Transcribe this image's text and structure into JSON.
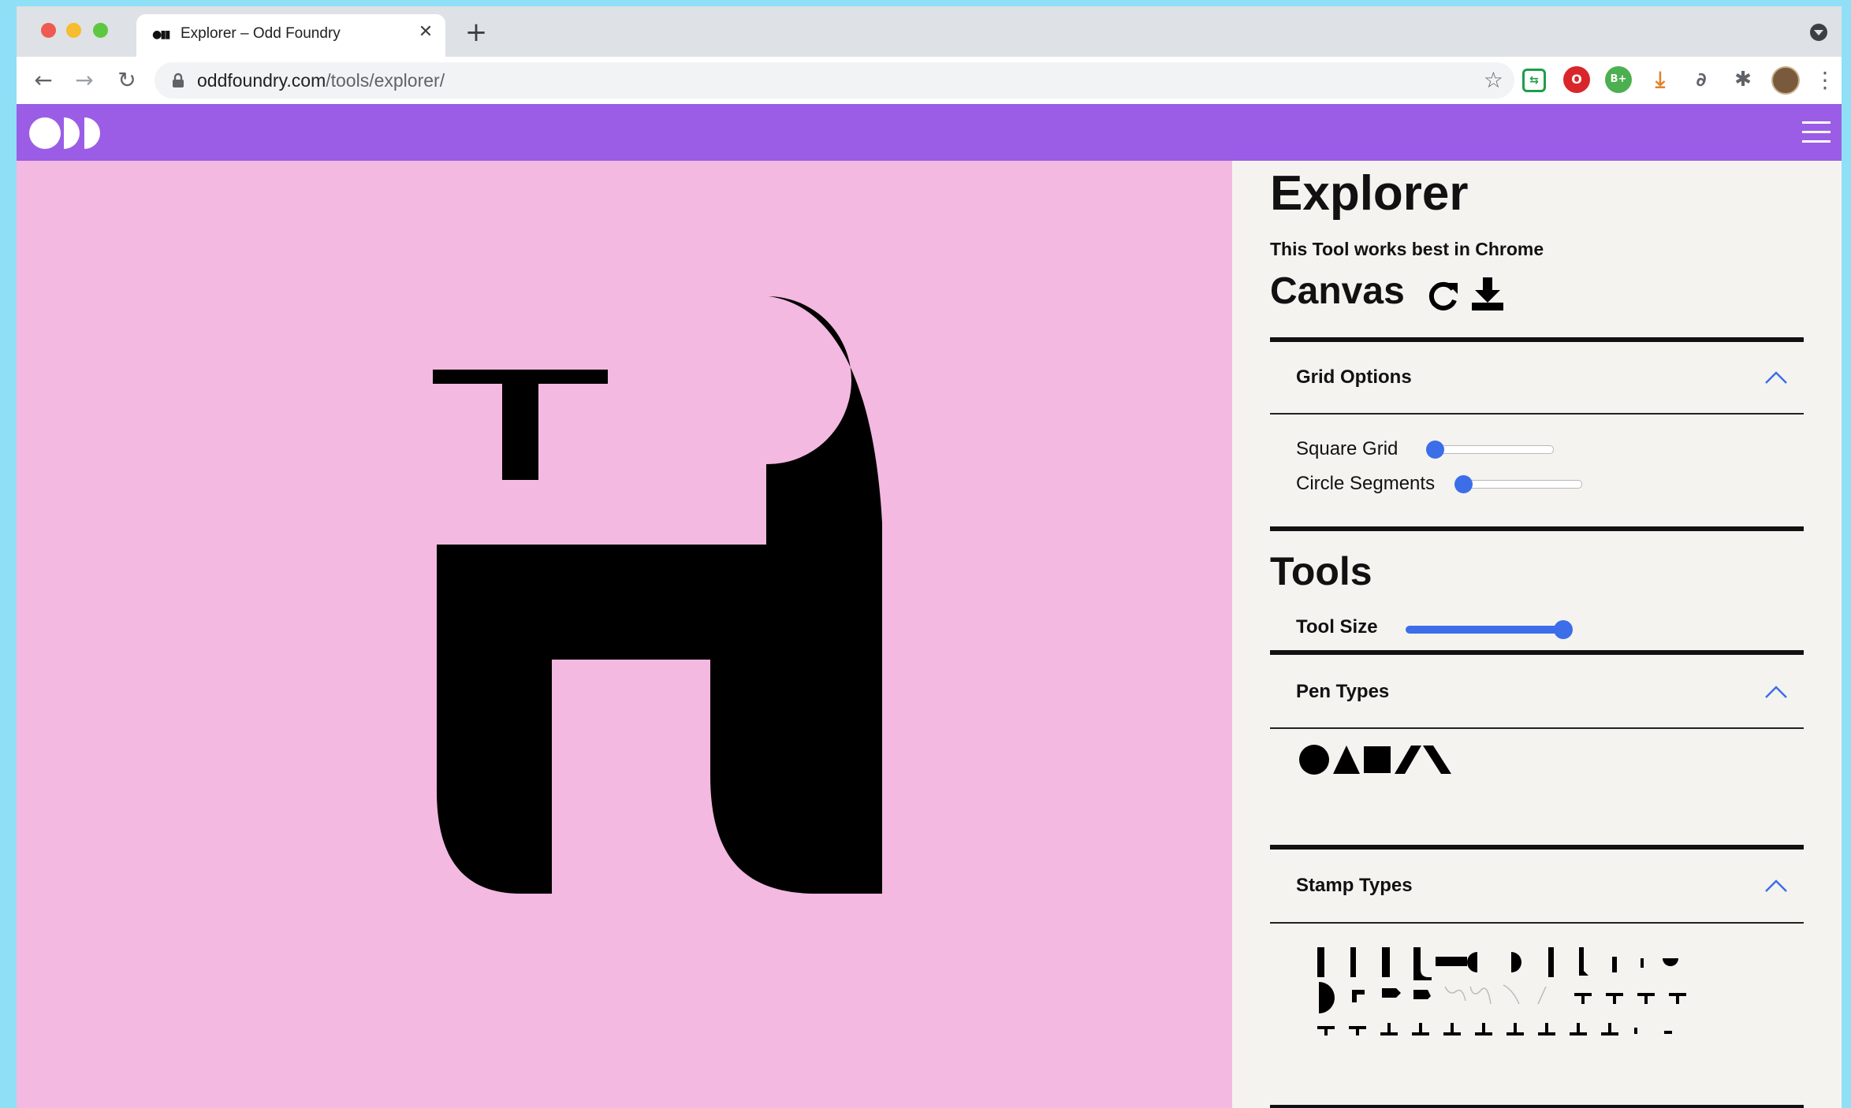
{
  "browser": {
    "tab_title": "Explorer – Odd Foundry",
    "tab_favicon": "●▮▮",
    "url_host": "oddfoundry.com",
    "url_path": "/tools/explorer/",
    "icons": {
      "back": "←",
      "forward": "→",
      "reload": "↻",
      "close_tab": "✕",
      "new_tab": "+",
      "star": "☆",
      "menu": "⋮"
    },
    "extensions": [
      {
        "name": "green-shield-extension-icon",
        "glyph": "⇆",
        "color": "#1e9e4a"
      },
      {
        "name": "red-adblock-extension-icon",
        "glyph": "O",
        "color": "#d9262a"
      },
      {
        "name": "green-b-extension-icon",
        "glyph": "B+",
        "color": "#4caf50"
      },
      {
        "name": "download-extension-icon",
        "glyph": "⤓",
        "color": "#e0822a"
      },
      {
        "name": "link-extension-icon",
        "glyph": "∂",
        "color": "#5f6368"
      },
      {
        "name": "puzzle-extension-icon",
        "glyph": "✱",
        "color": "#5f6368"
      }
    ]
  },
  "site": {
    "brand_color": "#9b5de5",
    "canvas_color": "#f3b9e0"
  },
  "panel": {
    "title": "Explorer",
    "note": "This Tool works best in Chrome",
    "canvas_heading": "Canvas",
    "grid_options": {
      "heading": "Grid Options",
      "square_grid_label": "Square Grid",
      "square_grid_value": 0,
      "circle_segments_label": "Circle Segments",
      "circle_segments_value": 0
    },
    "tools_heading": "Tools",
    "tool_size_label": "Tool Size",
    "tool_size_value": 1.0,
    "pen_types_heading": "Pen Types",
    "pen_types": [
      "circle",
      "triangle",
      "square",
      "slash",
      "backslash"
    ],
    "stamp_types_heading": "Stamp Types"
  }
}
